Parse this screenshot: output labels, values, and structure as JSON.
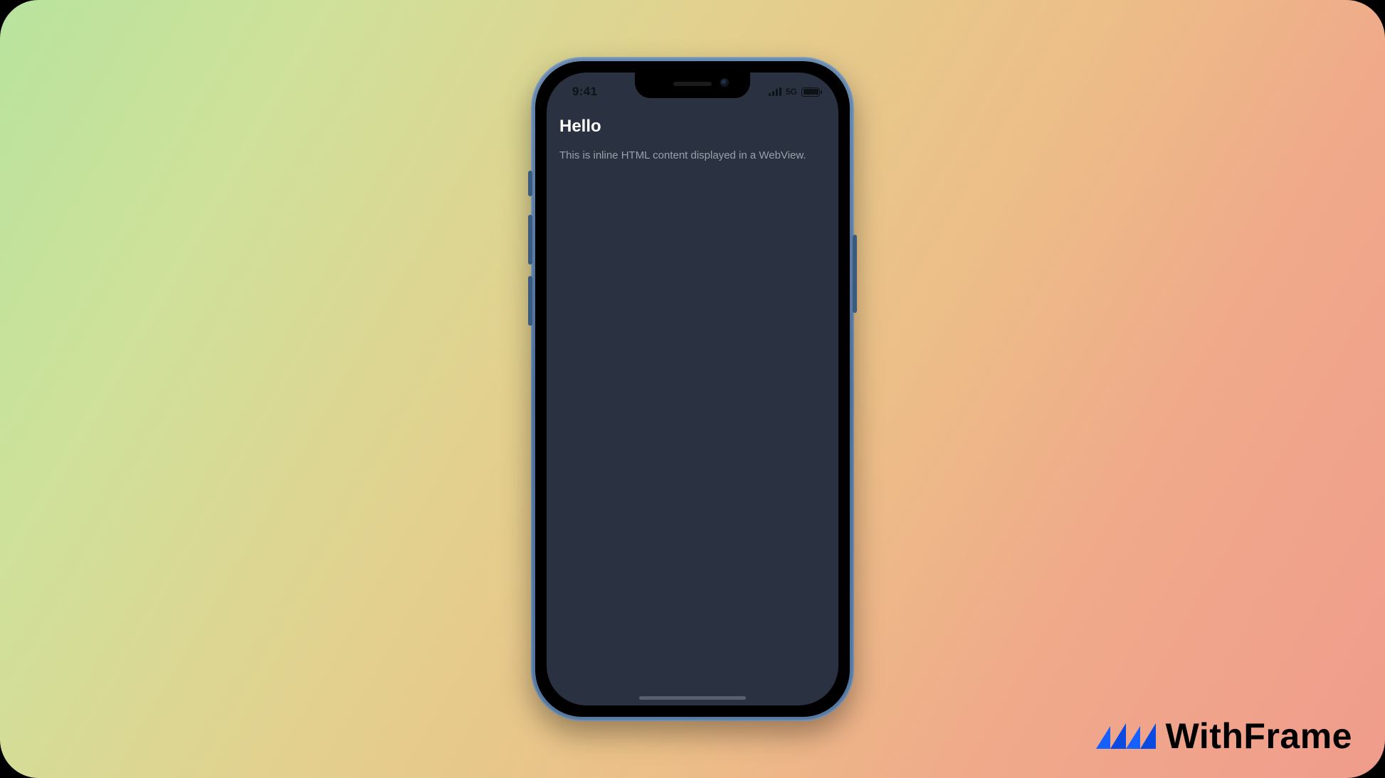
{
  "statusbar": {
    "time": "9:41",
    "network": "5G"
  },
  "webview": {
    "title": "Hello",
    "body": "This is inline HTML content displayed in a WebView."
  },
  "brand": {
    "name": "WithFrame"
  }
}
